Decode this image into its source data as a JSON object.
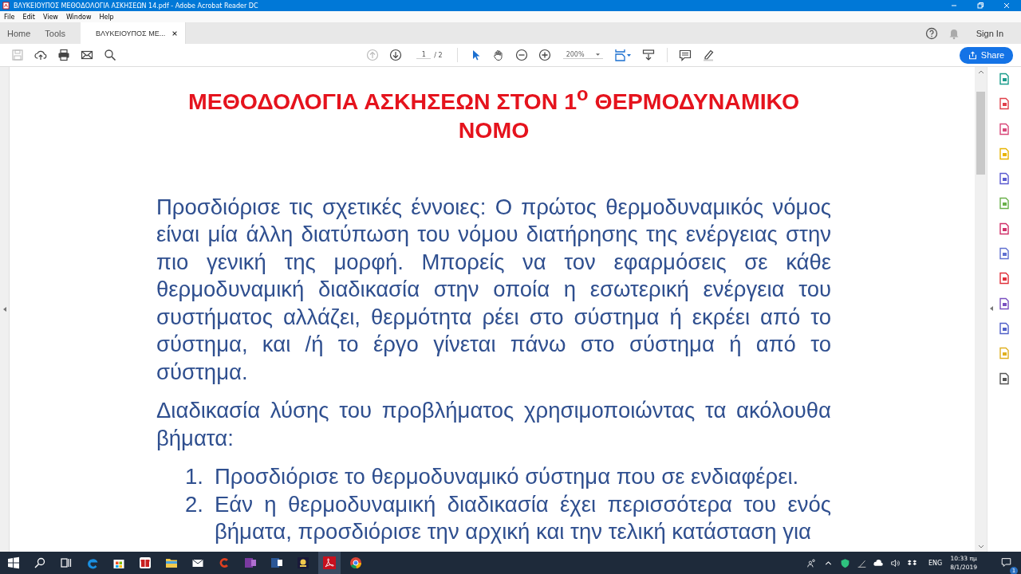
{
  "window": {
    "title": "ΒΛΥΚΕΙΟΥΠΟΣ ΜΕΘΟΔΟΛΟΓΙΑ ΑΣΚΗΣΕΩΝ 14.pdf - Adobe Acrobat Reader DC"
  },
  "menu": [
    "File",
    "Edit",
    "View",
    "Window",
    "Help"
  ],
  "tabs": [
    {
      "label": "Home",
      "selected": false
    },
    {
      "label": "Tools",
      "selected": false
    },
    {
      "label": "ΒΛΥΚΕΙΟΥΠΟΣ ΜΕ...",
      "selected": true
    }
  ],
  "sign_in": "Sign In",
  "toolbar": {
    "page": "1",
    "page_total": "/ 2",
    "zoom": "200%",
    "share": "Share"
  },
  "document": {
    "title": "ΜΕΘΟΔΟΛΟΓΙΑ ΑΣΚΗΣΕΩΝ ΣΤΟΝ 1$^{ο}$ ΘΕΡΜΟΔΥΝΑΜΙΚΟ ΝΟΜΟ",
    "paragraphs": [
      "Προσδιόρισε τις σχετικές έννοιες: Ο πρώτος θερμοδυναμικός νόμος είναι μία άλλη διατύπωση του νόμου διατήρησης της ενέργειας στην πιο γενική της μορφή. Μπορείς να τον εφαρμόσεις σε κάθε θερμοδυναμική διαδικασία στην οποία η εσωτερική ενέργεια του συστήματος αλλάζει, θερμότητα ρέει στο σύστημα ή εκρέει από το σύστημα, και /ή το έργο γίνεται πάνω στο σύστημα ή από το σύστημα.",
      "Διαδικασία λύσης του προβλήματος χρησιμοποιώντας τα ακόλουθα βήματα:"
    ],
    "steps": [
      {
        "number": "1.",
        "text": "Προσδιόρισε το θερμοδυναμικό σύστημα που σε ενδιαφέρει."
      },
      {
        "number": "2.",
        "text": "Εάν η θερμοδυναμική διαδικασία έχει περισσότερα του ενός βήματα, προσδιόρισε την αρχική και την τελική κατάσταση για"
      }
    ]
  },
  "taskbar": {
    "language": "ENG",
    "time": "10:33 πμ",
    "date": "8/1/2019",
    "notifications": "1"
  }
}
